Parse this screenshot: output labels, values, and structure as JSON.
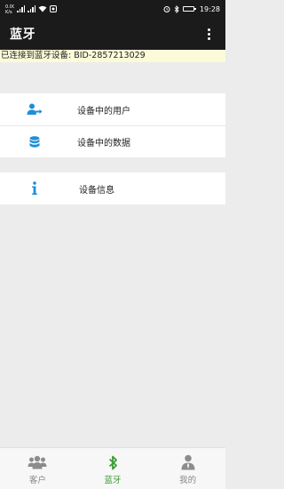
{
  "status_bar": {
    "speed": "0.00 K/s",
    "time": "19:28"
  },
  "app_bar": {
    "title": "蓝牙"
  },
  "connection": {
    "text": "已连接到蓝牙设备: BID-2857213029"
  },
  "menu": {
    "items": [
      {
        "label": "设备中的用户",
        "icon": "user-transfer-icon"
      },
      {
        "label": "设备中的数据",
        "icon": "database-icon"
      },
      {
        "label": "设备信息",
        "icon": "info-icon"
      }
    ]
  },
  "tabs": [
    {
      "label": "客户",
      "icon": "customers-icon",
      "active": false
    },
    {
      "label": "蓝牙",
      "icon": "bluetooth-icon",
      "active": true
    },
    {
      "label": "我的",
      "icon": "profile-icon",
      "active": false
    }
  ],
  "colors": {
    "accent_blue": "#1e8ed8",
    "tab_active": "#3d9b38",
    "tab_inactive": "#8c8c8c",
    "appbar": "#1b1b1b"
  }
}
